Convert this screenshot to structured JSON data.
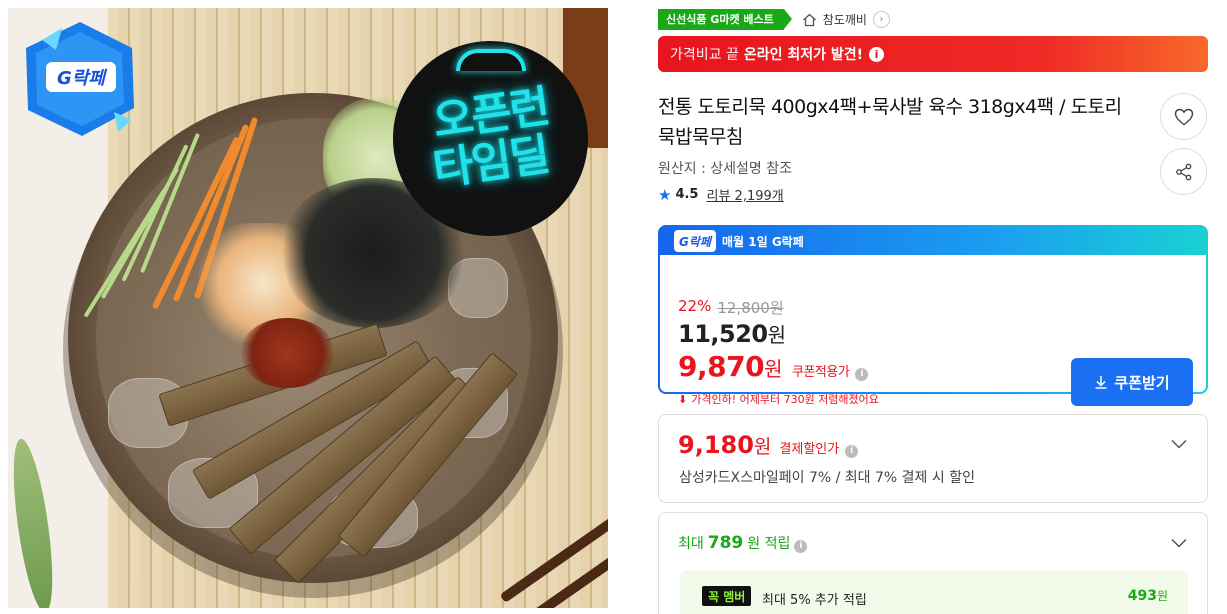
{
  "image": {
    "badge_text": "G락페",
    "timedeal_line1": "오픈런",
    "timedeal_line2": "타임딜"
  },
  "badges": {
    "best": "신선식품 G마켓 베스트",
    "shop_name": "참도깨비"
  },
  "banner": {
    "light_text": "가격비교 끝",
    "strong_text": "온라인 최저가 발견!"
  },
  "product": {
    "title": "전통 도토리묵 400gx4팩+묵사발 육수 318gx4팩 / 도토리묵밥묵무침",
    "origin": "원산지 : 상세설명 참조",
    "rating": "4.5",
    "review_label": "리뷰",
    "review_count": "2,199개"
  },
  "glak": {
    "logo": "G락페",
    "title": "매월 1일 G락페",
    "discount_rate": "22%",
    "original_price": "12,800원",
    "sale_price": "11,520",
    "won": "원",
    "coupon_price": "9,870",
    "coupon_label": "쿠폰적용가",
    "price_drop": "가격인하! 어제부터 730원 저렴해졌어요",
    "coupon_button": "쿠폰받기"
  },
  "card_discount": {
    "price": "9,180",
    "won": "원",
    "label": "결제할인가",
    "desc": "삼성카드X스마일페이 7% / 최대 7% 결제 시 할인"
  },
  "points": {
    "prefix": "최대",
    "amount": "789",
    "suffix": "원 적립",
    "member_badge": "꼭 멤버",
    "member_text": "최대 5% 추가 적립",
    "member_amount": "493",
    "won": "원"
  },
  "colors": {
    "accent_red": "#e8141e",
    "accent_blue": "#1b6ff2",
    "accent_green": "#19a818"
  }
}
